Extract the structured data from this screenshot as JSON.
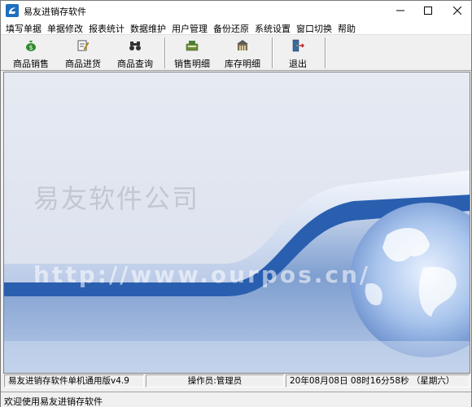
{
  "window": {
    "title": "易友进销存软件"
  },
  "menu": [
    {
      "label": "填写单据"
    },
    {
      "label": "单据修改"
    },
    {
      "label": "报表统计"
    },
    {
      "label": "数据维护"
    },
    {
      "label": "用户管理"
    },
    {
      "label": "备份还原"
    },
    {
      "label": "系统设置"
    },
    {
      "label": "窗口切换"
    },
    {
      "label": "帮助"
    }
  ],
  "toolbar": [
    {
      "label": "商品销售",
      "icon": "money-bag-icon"
    },
    {
      "label": "商品进货",
      "icon": "edit-document-icon"
    },
    {
      "label": "商品查询",
      "icon": "binoculars-icon"
    },
    {
      "label": "销售明细",
      "icon": "cash-register-icon"
    },
    {
      "label": "库存明细",
      "icon": "warehouse-icon"
    },
    {
      "label": "退出",
      "icon": "exit-door-icon"
    }
  ],
  "splash": {
    "company": "易友软件公司",
    "url": "http://www.ourpos.cn/"
  },
  "status": {
    "version": "易友进销存软件单机通用版v4.9",
    "operator": "操作员:管理员",
    "datetime": "20年08月08日  08时16分58秒 （星期六）"
  },
  "bottom": {
    "welcome": "欢迎使用易友进销存软件"
  },
  "colors": {
    "accent_blue": "#2a5fb0",
    "background": "#dfe5f0"
  }
}
